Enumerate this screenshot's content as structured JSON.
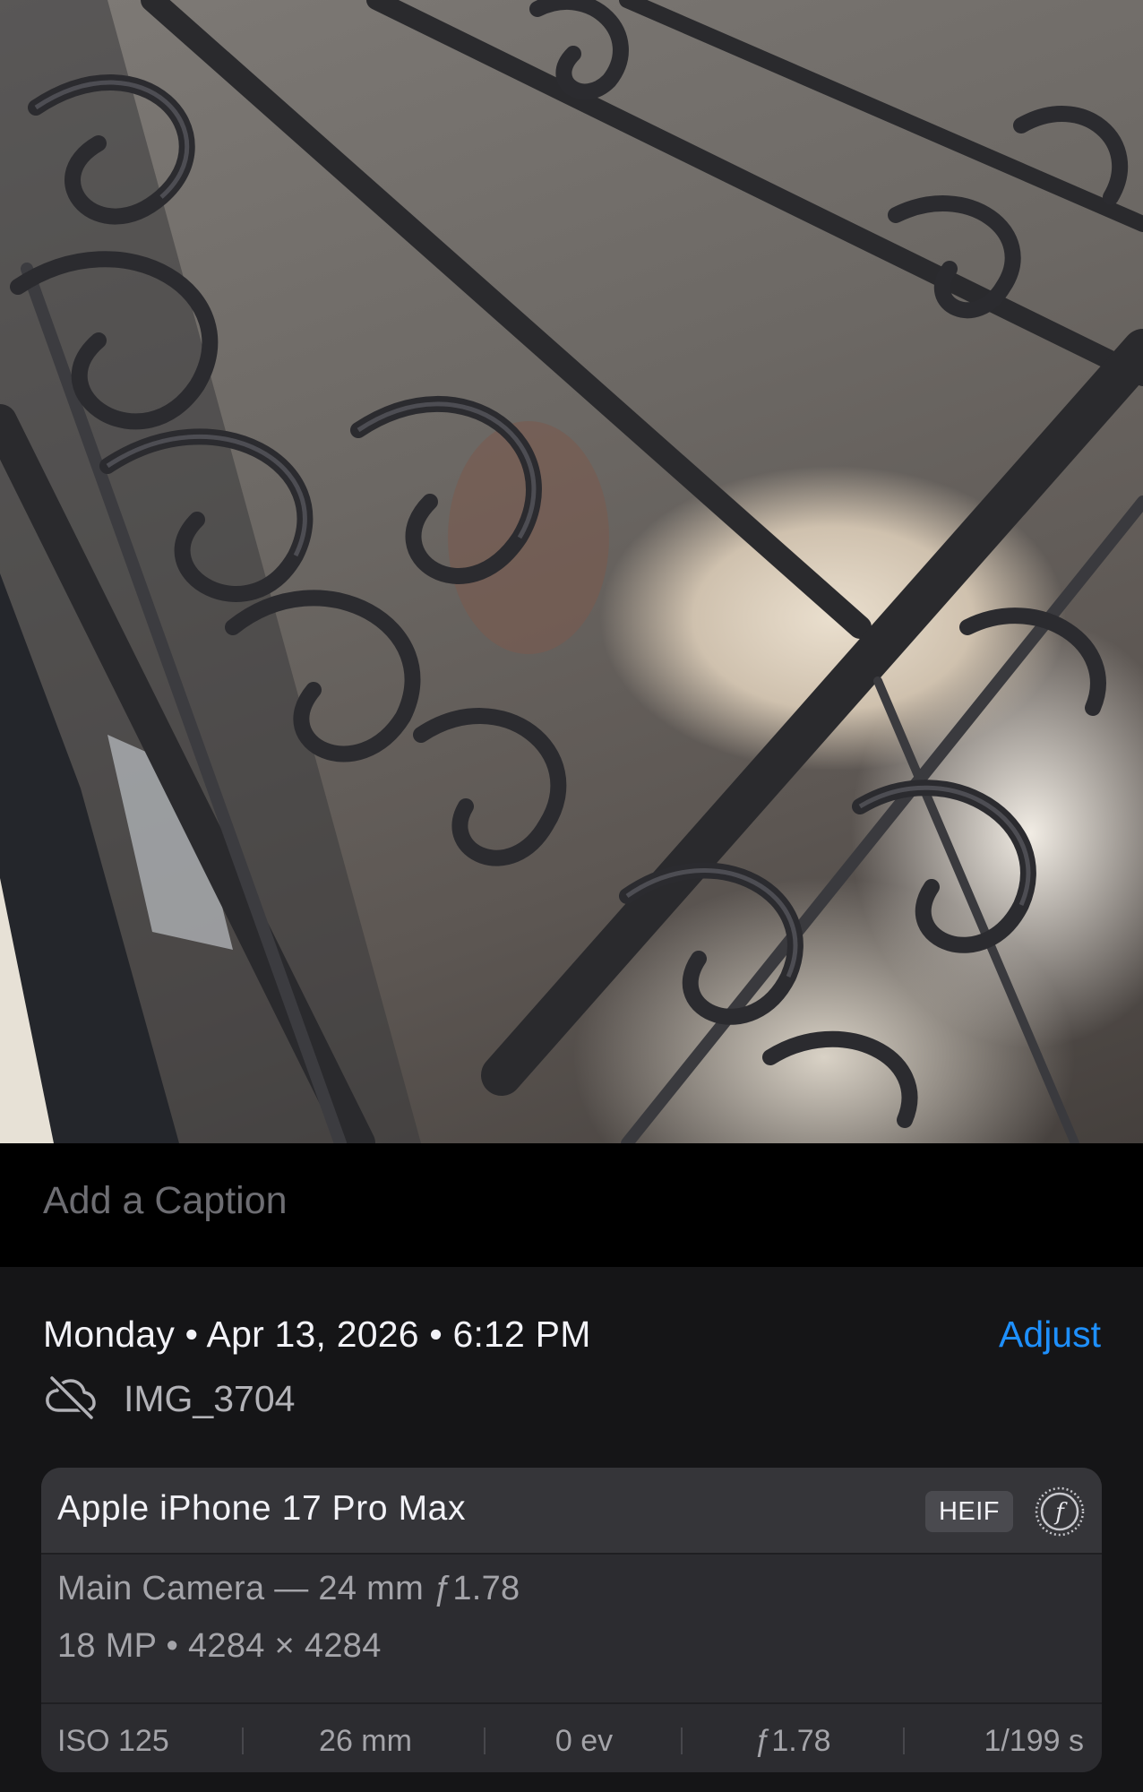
{
  "caption": {
    "placeholder": "Add a Caption"
  },
  "details": {
    "date": "Monday • Apr 13, 2026 • 6:12 PM",
    "adjust_label": "Adjust",
    "filename": "IMG_3704",
    "cloud_icon": "cloud-slash-icon"
  },
  "camera": {
    "device": "Apple iPhone 17 Pro Max",
    "format": "HEIF",
    "format_icon": "fstop-icon",
    "lens": "Main Camera — 24 mm ƒ1.78",
    "resolution": "18 MP • 4284 × 4284",
    "exif": {
      "iso": "ISO 125",
      "focal_length": "26 mm",
      "exposure_bias": "0 ev",
      "aperture": "ƒ1.78",
      "shutter": "1/199 s"
    }
  },
  "colors": {
    "accent": "#1e90ff",
    "background": "#151517",
    "card": "#2c2c30"
  }
}
